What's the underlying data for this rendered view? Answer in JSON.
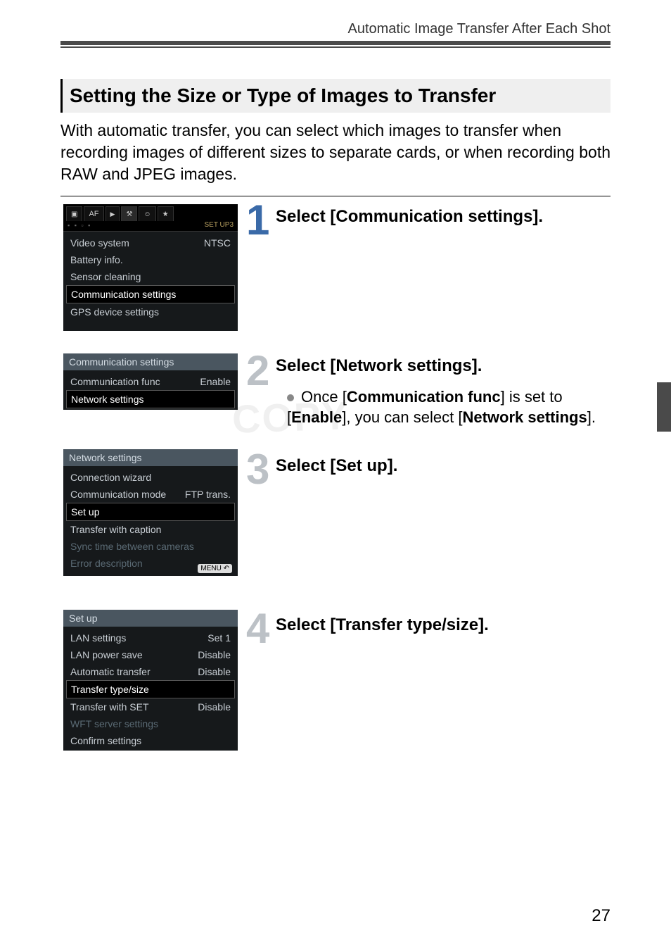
{
  "header": {
    "breadcrumb": "Automatic Image Transfer After Each Shot"
  },
  "section": {
    "title": "Setting the Size or Type of Images to Transfer",
    "intro": "With automatic transfer, you can select which images to transfer when recording images of different sizes to separate cards, or when recording both RAW and JPEG images."
  },
  "watermark": "COPY",
  "page_number": "27",
  "steps": {
    "s1": {
      "num": "1",
      "title": "Select [Communication settings]."
    },
    "s2": {
      "num": "2",
      "title": "Select [Network settings].",
      "bullet_pre": "Once [",
      "bullet_b1": "Communication func",
      "bullet_mid1": "] is set to [",
      "bullet_b2": "Enable",
      "bullet_mid2": "], you can select [",
      "bullet_b3": "Network settings",
      "bullet_post": "]."
    },
    "s3": {
      "num": "3",
      "title": "Select [Set up]."
    },
    "s4": {
      "num": "4",
      "title": "Select [Transfer type/size]."
    }
  },
  "shot1": {
    "tabs": {
      "af": "AF"
    },
    "setup_label": "SET UP3",
    "dots": "▪ ▪ ▫ ▪",
    "rows": {
      "video_l": "Video system",
      "video_v": "NTSC",
      "batt": "Battery info.",
      "sensor": "Sensor cleaning",
      "comm": "Communication settings",
      "gps": "GPS device settings"
    }
  },
  "shot2": {
    "title": "Communication settings",
    "rows": {
      "func_l": "Communication func",
      "func_v": "Enable",
      "net": "Network settings"
    }
  },
  "shot3": {
    "title": "Network settings",
    "rows": {
      "wiz": "Connection wizard",
      "mode_l": "Communication mode",
      "mode_v": "FTP trans.",
      "setup": "Set up",
      "cap": "Transfer with caption",
      "sync": "Sync time between cameras",
      "err": "Error description"
    },
    "menu_badge": "MENU"
  },
  "shot4": {
    "title": "Set up",
    "rows": {
      "lan_l": "LAN settings",
      "lan_v": "Set 1",
      "pow_l": "LAN power save",
      "pow_v": "Disable",
      "auto_l": "Automatic transfer",
      "auto_v": "Disable",
      "type": "Transfer type/size",
      "tset_l": "Transfer with SET",
      "tset_v": "Disable",
      "wft": "WFT server settings",
      "conf": "Confirm settings"
    }
  }
}
